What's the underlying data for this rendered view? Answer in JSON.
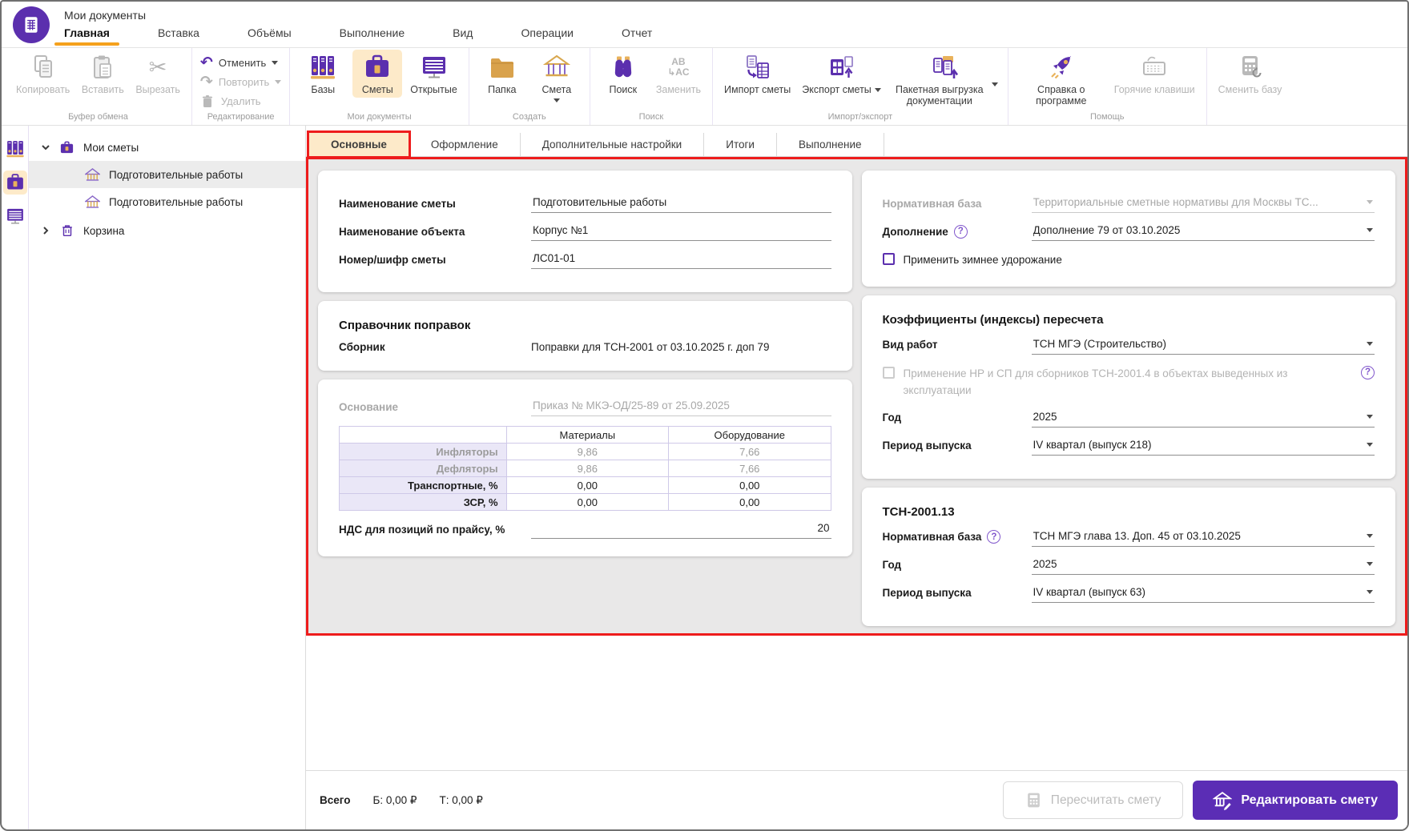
{
  "colors": {
    "accent_purple": "#5b2fae",
    "edit_button_purple": "#5b2db5",
    "selected_yellow": "#fdeac9",
    "active_tab_underline_orange": "#f5a11d",
    "annotation_red": "#ee1c1c",
    "folder_tan": "#d9a24c",
    "table_label_lavender": "#eae7f7"
  },
  "glyphs": {
    "cut": "✂",
    "undo": "↶",
    "redo": "↷",
    "replace_top": "AB",
    "replace_bottom": "↳AC",
    "help": "?"
  },
  "app": {
    "title": "Мои документы"
  },
  "menu": {
    "items": [
      {
        "label": "Главная"
      },
      {
        "label": "Вставка"
      },
      {
        "label": "Объёмы"
      },
      {
        "label": "Выполнение"
      },
      {
        "label": "Вид"
      },
      {
        "label": "Операции"
      },
      {
        "label": "Отчет"
      }
    ]
  },
  "ribbon": {
    "clipboard": {
      "group": "Буфер обмена",
      "copy": "Копировать",
      "paste": "Вставить",
      "cut": "Вырезать"
    },
    "editing": {
      "group": "Редактирование",
      "undo": "Отменить",
      "redo": "Повторить",
      "delete": "Удалить"
    },
    "docs": {
      "group": "Мои документы",
      "bases": "Базы",
      "estimates": "Сметы",
      "opened": "Открытые"
    },
    "create": {
      "group": "Создать",
      "folder": "Папка",
      "estimate": "Смета"
    },
    "search": {
      "group": "Поиск",
      "find": "Поиск",
      "replace": "Заменить"
    },
    "impexp": {
      "group": "Импорт/экспорт",
      "import": "Импорт сметы",
      "export": "Экспорт сметы",
      "batch": "Пакетная выгрузка документации"
    },
    "help": {
      "group": "Помощь",
      "about": "Справка о программе",
      "hotkeys": "Горячие клавиши"
    },
    "base": {
      "change": "Сменить базу"
    }
  },
  "sidebar": {
    "items": [
      {
        "label": "Мои сметы"
      },
      {
        "label": "Подготовительные работы"
      },
      {
        "label": "Подготовительные работы"
      },
      {
        "label": "Корзина"
      }
    ]
  },
  "doc_tabs": {
    "items": [
      {
        "label": "Основные"
      },
      {
        "label": "Оформление"
      },
      {
        "label": "Дополнительные настройки"
      },
      {
        "label": "Итоги"
      },
      {
        "label": "Выполнение"
      }
    ]
  },
  "general": {
    "name_label": "Наименование сметы",
    "name_value": "Подготовительные работы",
    "object_label": "Наименование объекта",
    "object_value": "Корпус №1",
    "number_label": "Номер/шифр сметы",
    "number_value": "ЛС01-01"
  },
  "corrections": {
    "title": "Справочник поправок",
    "collection_label": "Сборник",
    "collection_value": "Поправки для ТСН-2001 от 03.10.2025 г. доп 79"
  },
  "basis": {
    "label": "Основание",
    "value": "Приказ № МКЭ-ОД/25-89 от 25.09.2025",
    "col_materials": "Материалы",
    "col_equipment": "Оборудование",
    "rows": [
      {
        "label": "Инфляторы",
        "materials": "9,86",
        "equipment": "7,66"
      },
      {
        "label": "Дефляторы",
        "materials": "9,86",
        "equipment": "7,66"
      },
      {
        "label": "Транспортные, %",
        "materials": "0,00",
        "equipment": "0,00"
      },
      {
        "label": "ЗСР, %",
        "materials": "0,00",
        "equipment": "0,00"
      }
    ],
    "vat_label": "НДС для позиций по прайсу, %",
    "vat_value": "20"
  },
  "normative": {
    "base_label": "Нормативная база",
    "base_value": "Территориальные сметные нормативы для Москвы ТС...",
    "supplement_label": "Дополнение",
    "supplement_value": "Дополнение 79 от 03.10.2025",
    "winter_checkbox": "Применить зимнее удорожание"
  },
  "coefficients": {
    "title": "Коэффициенты (индексы) пересчета",
    "work_type_label": "Вид работ",
    "work_type_value": "ТСН МГЭ (Строительство)",
    "nr_sp_checkbox": "Применение НР и СП для сборников ТСН-2001.4 в объектах выведенных из эксплуатации",
    "year_label": "Год",
    "year_value": "2025",
    "period_label": "Период выпуска",
    "period_value": "IV квартал (выпуск 218)"
  },
  "tsn13": {
    "title": "ТСН-2001.13",
    "base_label": "Нормативная база",
    "base_value": "ТСН МГЭ глава 13. Доп. 45 от 03.10.2025",
    "year_label": "Год",
    "year_value": "2025",
    "period_label": "Период выпуска",
    "period_value": "IV квартал (выпуск 63)"
  },
  "footer": {
    "total_label": "Всего",
    "base_total": "Б: 0,00 ₽",
    "current_total": "Т: 0,00 ₽",
    "recalc_button": "Пересчитать смету",
    "edit_button": "Редактировать смету"
  }
}
